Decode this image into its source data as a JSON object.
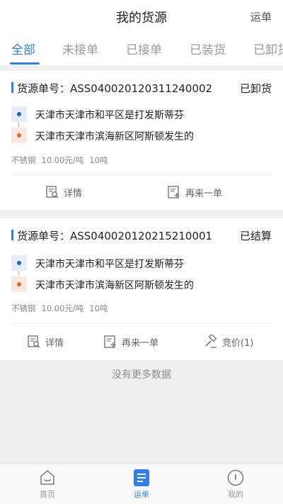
{
  "header": {
    "title": "我的货源",
    "right_link": "运单"
  },
  "tabs": [
    {
      "label": "全部",
      "active": true
    },
    {
      "label": "未接单"
    },
    {
      "label": "已接单"
    },
    {
      "label": "已装货"
    },
    {
      "label": "已卸货"
    }
  ],
  "orders": [
    {
      "order_label": "货源单号：ASS040020120311240002",
      "status": "已卸货",
      "from": "天津市天津市和平区是打发斯蒂芬",
      "to": "天津市天津市滨海新区阿斯顿发生的",
      "goods": "不锈钢",
      "price": "10.00元/吨",
      "weight": "10吨",
      "actions": {
        "detail": "详情",
        "reorder": "再来一单"
      }
    },
    {
      "order_label": "货源单号：ASS040020120215210001",
      "status": "已结算",
      "from": "天津市天津市和平区是打发斯蒂芬",
      "to": "天津市天津市滨海新区阿斯顿发生的",
      "goods": "不锈钢",
      "price": "10.00元/吨",
      "weight": "10吨",
      "actions": {
        "detail": "详情",
        "reorder": "再来一单",
        "bid": "竞价(1)"
      }
    }
  ],
  "no_more": "没有更多数据",
  "tabbar": [
    {
      "label": "首页",
      "icon": "home-icon"
    },
    {
      "label": "运单",
      "icon": "waybill-icon",
      "active": true
    },
    {
      "label": "我的",
      "icon": "profile-icon"
    }
  ],
  "colors": {
    "accent": "#2f7ff0",
    "origin": "#1f5fd6",
    "destination": "#e06a2c"
  }
}
